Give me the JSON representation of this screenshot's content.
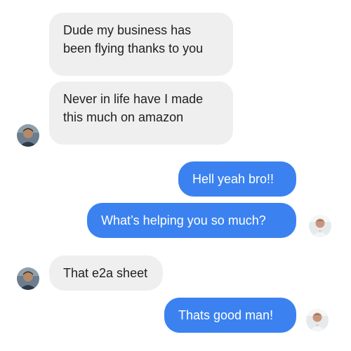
{
  "conversation": {
    "messages": [
      {
        "sender": "them",
        "lines": [
          "Dude my business has",
          "been flying thanks to you"
        ]
      },
      {
        "sender": "them",
        "lines": [
          "Never in life have I made",
          "this much on amazon"
        ]
      },
      {
        "sender": "me",
        "lines": [
          "Hell yeah bro!!"
        ]
      },
      {
        "sender": "me",
        "lines": [
          "What’s helping you so much?"
        ]
      },
      {
        "sender": "them",
        "lines": [
          "That e2a sheet"
        ]
      },
      {
        "sender": "me",
        "lines": [
          "Thats good man!"
        ]
      }
    ]
  },
  "icons": {
    "contact_avatar": "contact-avatar-icon",
    "user_avatar": "user-avatar-icon"
  },
  "colors": {
    "incoming_bubble": "#efefef",
    "outgoing_bubble": "#3b82f0",
    "incoming_text": "#1f1f1f",
    "outgoing_text": "#ffffff"
  }
}
